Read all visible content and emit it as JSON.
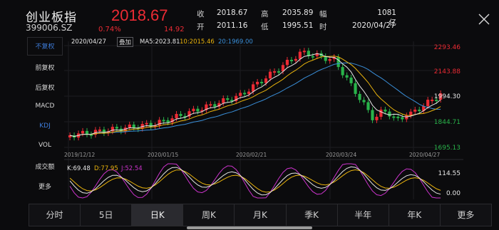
{
  "header": {
    "name": "创业板指",
    "code": "399006.SZ",
    "price": "2018.67",
    "change_pct": "0.74%",
    "change_abs": "14.92",
    "stats": [
      {
        "key": "收",
        "value": "2018.67"
      },
      {
        "key": "高",
        "value": "2035.89"
      },
      {
        "key": "幅",
        "value": "1081亿"
      },
      {
        "key": "开",
        "value": "2011.16"
      },
      {
        "key": "低",
        "value": "1995.51"
      },
      {
        "key": "时",
        "value": "2020/04/27"
      }
    ]
  },
  "side_menu": [
    {
      "label": "不复权",
      "active": true
    },
    {
      "label": "前复权",
      "active": false
    },
    {
      "label": "后复权",
      "active": false
    },
    {
      "label": "MACD",
      "active": false
    },
    {
      "label": "KDJ",
      "active": true
    },
    {
      "label": "VOL",
      "active": false
    },
    {
      "label": "成交额",
      "active": false
    },
    {
      "label": "更多",
      "active": false
    }
  ],
  "legend": {
    "date": "2020/04/27",
    "adjust_tag": "叠加",
    "ma5": "MA5:2023.81",
    "ma10": "10:2015.46",
    "ma20": "20:1969.00",
    "kdj_k": "K:69.48",
    "kdj_d": "D:77.95",
    "kdj_j": "J:52.54"
  },
  "chart_data": {
    "type": "candlestick",
    "price_axis_labels": [
      "2293.46",
      "2143.88",
      "1994.30",
      "1844.71",
      "1695.13"
    ],
    "kdj_axis_labels": [
      "114.55",
      "0.00"
    ],
    "date_labels": [
      "2019/12/12",
      "2020/01/15",
      "2020/02/21",
      "2020/03/24",
      "2020/04/27"
    ],
    "colors": {
      "up": "#ec2b34",
      "down": "#29b34a",
      "ma5": "#e6e6e6",
      "ma10": "#e8b20c",
      "ma20": "#3a8fd9",
      "k": "#e6e6e6",
      "d": "#e8b20c",
      "j": "#cc33cc"
    }
  },
  "tabs": [
    {
      "label": "分时",
      "active": false
    },
    {
      "label": "5日",
      "active": false
    },
    {
      "label": "日K",
      "active": true
    },
    {
      "label": "周K",
      "active": false
    },
    {
      "label": "月K",
      "active": false
    },
    {
      "label": "季K",
      "active": false
    },
    {
      "label": "半年",
      "active": false
    },
    {
      "label": "年K",
      "active": false
    },
    {
      "label": "更多",
      "active": false
    }
  ]
}
